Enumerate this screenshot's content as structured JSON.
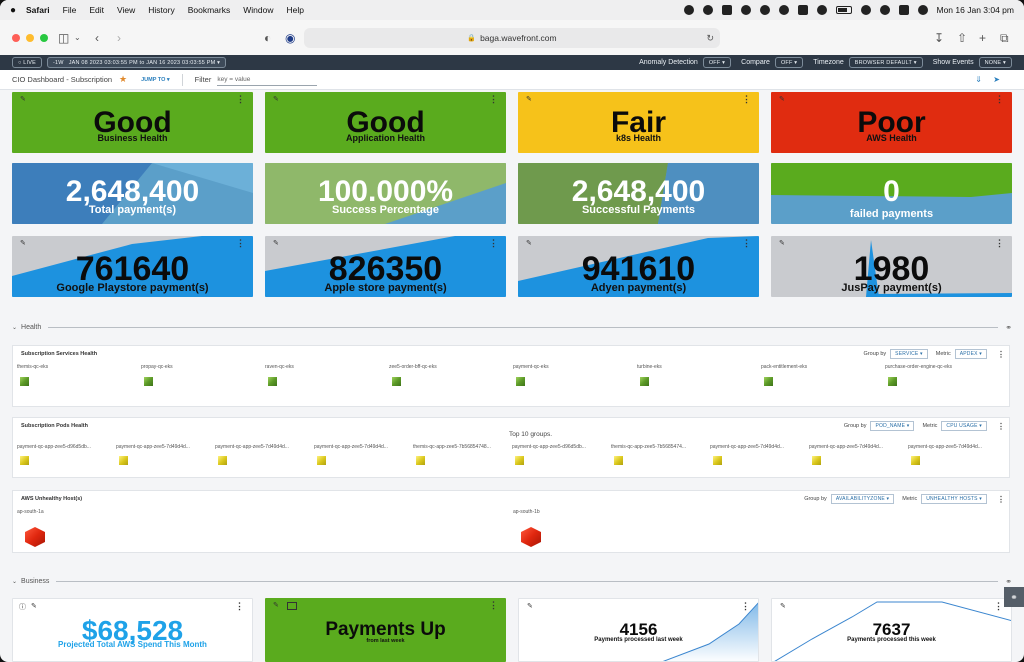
{
  "menubar": {
    "app": "Safari",
    "items": [
      "File",
      "Edit",
      "View",
      "History",
      "Bookmarks",
      "Window",
      "Help"
    ],
    "clock": "Mon 16 Jan  3:04 pm"
  },
  "browser": {
    "url": "baga.wavefront.com"
  },
  "topbar": {
    "live": "LIVE",
    "range_btn": "-1W",
    "range_text": "JAN 08 2023 03:03:55 PM  to  JAN 16 2023 03:03:55 PM",
    "anomaly_label": "Anomaly Detection",
    "anomaly_value": "OFF",
    "compare_label": "Compare",
    "compare_value": "OFF",
    "timezone_label": "Timezone",
    "timezone_value": "BROWSER DEFAULT",
    "events_label": "Show Events",
    "events_value": "NONE"
  },
  "dashboard": {
    "title": "CIO Dashboard - Subscription",
    "jump_to": "JUMP TO",
    "filter_label": "Filter",
    "filter_placeholder": "key = value"
  },
  "status_tiles": [
    {
      "value": "Good",
      "label": "Business Health",
      "color": "#5aab1e"
    },
    {
      "value": "Good",
      "label": "Application Health",
      "color": "#5aab1e"
    },
    {
      "value": "Fair",
      "label": "k8s Health",
      "color": "#f6c21a"
    },
    {
      "value": "Poor",
      "label": "AWS Health",
      "color": "#e02c10"
    }
  ],
  "kpi_tiles": [
    {
      "value": "2,648,400",
      "label": "Total payment(s)"
    },
    {
      "value": "100.000%",
      "label": "Success Percentage"
    },
    {
      "value": "2,648,400",
      "label": "Successful Payments"
    },
    {
      "value": "0",
      "label": "failed payments"
    }
  ],
  "payment_tiles": [
    {
      "value": "761640",
      "label": "Google Playstore payment(s)"
    },
    {
      "value": "826350",
      "label": "Apple store payment(s)"
    },
    {
      "value": "941610",
      "label": "Adyen payment(s)"
    },
    {
      "value": "1980",
      "label": "JusPay payment(s)"
    }
  ],
  "health_section": {
    "title": "Health",
    "services": {
      "title": "Subscription Services Health",
      "group_by_label": "Group by",
      "group_by_value": "SERVICE",
      "metric_label": "Metric",
      "metric_value": "APDEX",
      "nodes": [
        "themis-qc-eks",
        "propay-qc-eks",
        "raven-qc-eks",
        "zee5-order-bff-qc-eks",
        "payment-qc-eks",
        "turbine-eks",
        "pack-entitlement-eks",
        "purchase-order-engine-qc-eks"
      ]
    },
    "pods": {
      "title": "Subscription Pods Health",
      "group_by_label": "Group by",
      "group_by_value": "POD_NAME",
      "metric_label": "Metric",
      "metric_value": "CPU USAGE",
      "top_groups": "Top 10 groups.",
      "nodes": [
        "payment-qc-app-zee5-d96d5db...",
        "payment-qc-app-zee5-7d49d4d...",
        "payment-qc-app-zee5-7d49d4d...",
        "payment-qc-app-zee5-7d49d4d...",
        "themis-qc-app-zee5-7b56854748...",
        "payment-qc-app-zee5-d96d5db...",
        "themis-qc-app-zee5-7b5685474...",
        "payment-qc-app-zee5-7d49d4d...",
        "payment-qc-app-zee5-7d49d4d...",
        "payment-qc-app-zee5-7d49d4d..."
      ]
    },
    "aws": {
      "title": "AWS Unhealthy Host(s)",
      "group_by_label": "Group by",
      "group_by_value": "AVAILABILITYZONE",
      "metric_label": "Metric",
      "metric_value": "UNHEALTHY HOSTS",
      "nodes": [
        "ap-south-1a",
        "ap-south-1b"
      ]
    }
  },
  "business_section": {
    "title": "Business",
    "spend": {
      "value": "$68,528",
      "label": "Projected Total AWS Spend This Month"
    },
    "payments_up": {
      "value": "Payments Up",
      "label": "from last week"
    },
    "last_week": {
      "value": "4156",
      "label": "Payments processed last week"
    },
    "this_week": {
      "value": "7637",
      "label": "Payments processed this week"
    }
  }
}
